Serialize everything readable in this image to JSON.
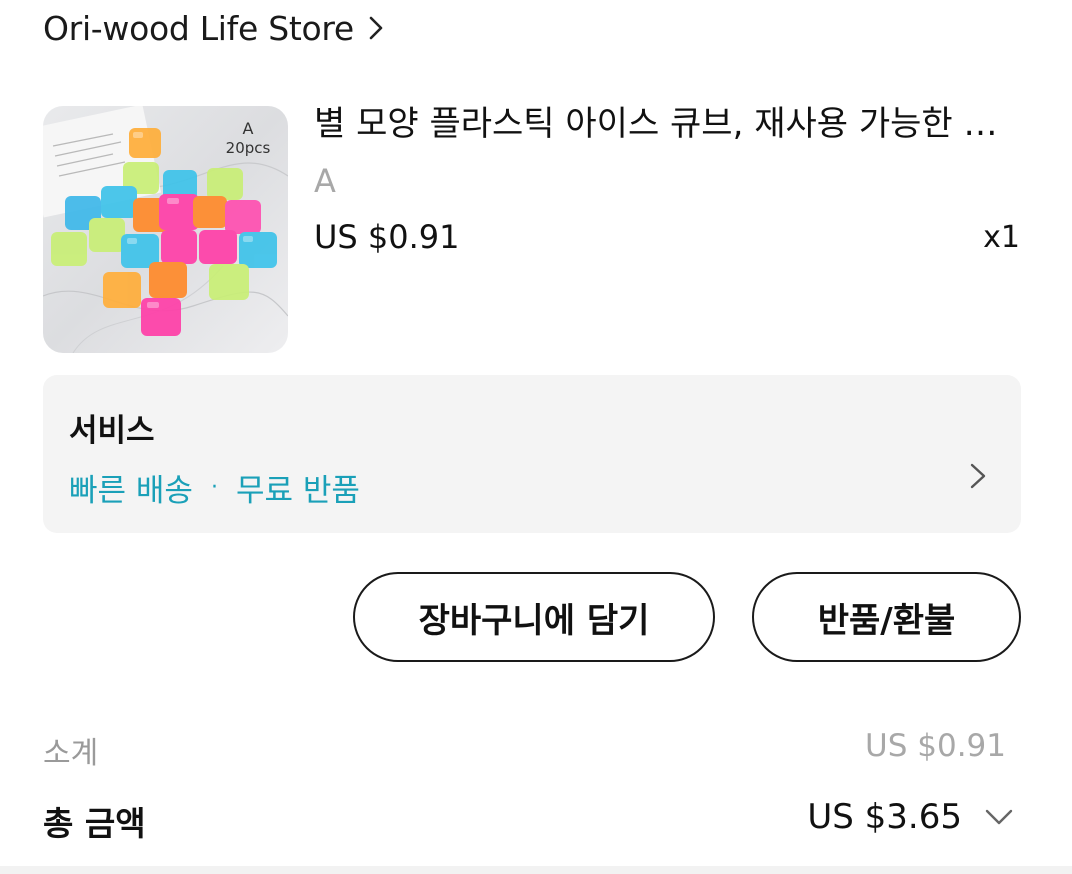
{
  "store": {
    "name": "Ori-wood Life Store"
  },
  "product": {
    "title": "별 모양 플라스틱 아이스 큐브, 재사용 가능한 아이스 큐브",
    "variant": "A",
    "price": "US $0.91",
    "quantity": "x1",
    "image_label_variant": "A",
    "image_label_count": "20pcs"
  },
  "service": {
    "title": "서비스",
    "features": [
      "빠른 배송",
      "무료 반품"
    ],
    "separator": "·"
  },
  "actions": {
    "add_to_cart": "장바구니에 담기",
    "return_refund": "반품/환불"
  },
  "summary": {
    "subtotal_label": "소계",
    "subtotal_value": "US $0.91",
    "total_label": "총 금액",
    "total_value": "US $3.65"
  },
  "colors": {
    "accent_teal": "#1aa0b8",
    "muted_text": "#a8a8a8",
    "card_bg": "#f4f4f4"
  },
  "icons": [
    "chevron-right-icon",
    "chevron-down-icon"
  ]
}
